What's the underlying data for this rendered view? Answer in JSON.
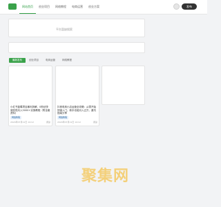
{
  "nav": {
    "items": [
      {
        "label": "网站首页",
        "active": true
      },
      {
        "label": "创业项目",
        "active": false
      },
      {
        "label": "网络教程",
        "active": false
      },
      {
        "label": "电商运营",
        "active": false
      },
      {
        "label": "创业方案",
        "active": false
      }
    ],
    "publish_label": "发布"
  },
  "search": {
    "placeholder": "平台暂缺搜索"
  },
  "filters": [
    {
      "label": "最新发布",
      "active": true
    },
    {
      "label": "创业项目",
      "active": false
    },
    {
      "label": "电商运营",
      "active": false
    },
    {
      "label": "网络教程",
      "active": false
    }
  ],
  "cards": [
    {
      "title": "小红书蓝莓项目暴利拆解，0粉丝快速变现月入5000+实操教程（附全套资料）",
      "tag": "网络教程",
      "date": "2024年07月11日 14:12",
      "views": "阅读"
    },
    {
      "title": "抖音电商小店运营全攻略：从零开始快速入门，新手也能月入过万，避坑指南分享",
      "tag": "网络教程",
      "date": "2024年07月11日 14:12",
      "views": "阅读"
    }
  ],
  "watermark": "聚集网",
  "colors": {
    "brand": "#3aa24a",
    "watermark": "#f4d07a"
  }
}
